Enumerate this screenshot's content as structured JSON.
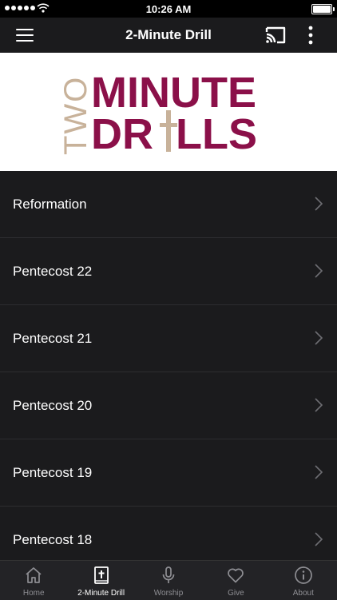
{
  "status_bar": {
    "time": "10:26 AM"
  },
  "nav_bar": {
    "title": "2-Minute Drill"
  },
  "banner": {
    "logo_text": "TWO MINUTE DRILLS"
  },
  "list": {
    "items": [
      {
        "label": "Reformation"
      },
      {
        "label": "Pentecost 22"
      },
      {
        "label": "Pentecost 21"
      },
      {
        "label": "Pentecost 20"
      },
      {
        "label": "Pentecost 19"
      },
      {
        "label": "Pentecost 18"
      }
    ]
  },
  "tab_bar": {
    "tabs": [
      {
        "label": "Home",
        "icon": "home-icon"
      },
      {
        "label": "2-Minute Drill",
        "icon": "bible-icon"
      },
      {
        "label": "Worship",
        "icon": "microphone-icon"
      },
      {
        "label": "Give",
        "icon": "heart-icon"
      },
      {
        "label": "About",
        "icon": "info-icon"
      }
    ],
    "active_index": 1
  },
  "colors": {
    "background": "#1b1b1d",
    "logo_maroon": "#8b1049",
    "logo_tan": "#c8b29a",
    "tab_active": "#ffffff",
    "tab_inactive": "#8e8e93"
  }
}
